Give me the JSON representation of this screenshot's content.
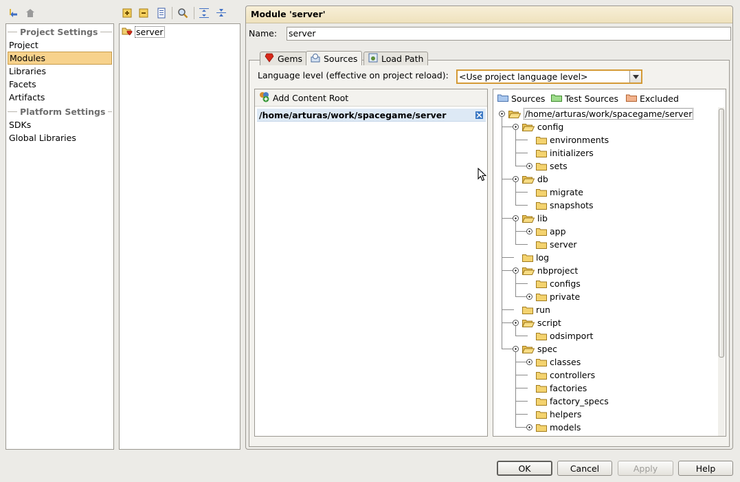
{
  "toolbar_left": {
    "icons": [
      "back-icon",
      "forward-icon"
    ]
  },
  "toolbar_mid": {
    "icons": [
      "add-icon",
      "remove-icon",
      "copy-icon",
      "find-icon",
      "expand-all-icon",
      "collapse-all-icon"
    ]
  },
  "nav": {
    "project_settings_header": "Project Settings",
    "platform_settings_header": "Platform Settings",
    "items": [
      "Project",
      "Modules",
      "Libraries",
      "Facets",
      "Artifacts"
    ],
    "platform_items": [
      "SDKs",
      "Global Libraries"
    ],
    "selected": "Modules"
  },
  "modules": {
    "items": [
      "server"
    ]
  },
  "module_panel": {
    "title": "Module 'server'",
    "name_label": "Name:",
    "name_value": "server",
    "tabs": [
      "Gems",
      "Sources",
      "Load Path"
    ],
    "active_tab": "Sources",
    "language_level_label": "Language level (effective on project reload):",
    "language_level_value": "<Use project language level>",
    "add_content_root": "Add Content Root",
    "content_root": "/home/arturas/work/spacegame/server",
    "legend": {
      "sources": "Sources",
      "test_sources": "Test Sources",
      "excluded": "Excluded"
    },
    "tree": [
      {
        "label": "/home/arturas/work/spacegame/server",
        "depth": 0,
        "expanded": true,
        "knob": true
      },
      {
        "label": "config",
        "depth": 1,
        "expanded": true,
        "knob": true
      },
      {
        "label": "environments",
        "depth": 2
      },
      {
        "label": "initializers",
        "depth": 2
      },
      {
        "label": "sets",
        "depth": 2,
        "knob": true
      },
      {
        "label": "db",
        "depth": 1,
        "expanded": true,
        "knob": true
      },
      {
        "label": "migrate",
        "depth": 2
      },
      {
        "label": "snapshots",
        "depth": 2
      },
      {
        "label": "lib",
        "depth": 1,
        "expanded": true,
        "knob": true
      },
      {
        "label": "app",
        "depth": 2,
        "knob": true
      },
      {
        "label": "server",
        "depth": 2
      },
      {
        "label": "log",
        "depth": 1
      },
      {
        "label": "nbproject",
        "depth": 1,
        "expanded": true,
        "knob": true
      },
      {
        "label": "configs",
        "depth": 2
      },
      {
        "label": "private",
        "depth": 2,
        "knob": true
      },
      {
        "label": "run",
        "depth": 1
      },
      {
        "label": "script",
        "depth": 1,
        "expanded": true,
        "knob": true
      },
      {
        "label": "odsimport",
        "depth": 2
      },
      {
        "label": "spec",
        "depth": 1,
        "expanded": true,
        "knob": true
      },
      {
        "label": "classes",
        "depth": 2,
        "knob": true
      },
      {
        "label": "controllers",
        "depth": 2
      },
      {
        "label": "factories",
        "depth": 2
      },
      {
        "label": "factory_specs",
        "depth": 2
      },
      {
        "label": "helpers",
        "depth": 2
      },
      {
        "label": "models",
        "depth": 2,
        "knob": true
      }
    ]
  },
  "buttons": {
    "ok": "OK",
    "cancel": "Cancel",
    "apply": "Apply",
    "help": "Help"
  },
  "colors": {
    "selection": "#f7d28c",
    "title_bar": "#f1e6c6",
    "row_highlight": "#dde9f5"
  }
}
